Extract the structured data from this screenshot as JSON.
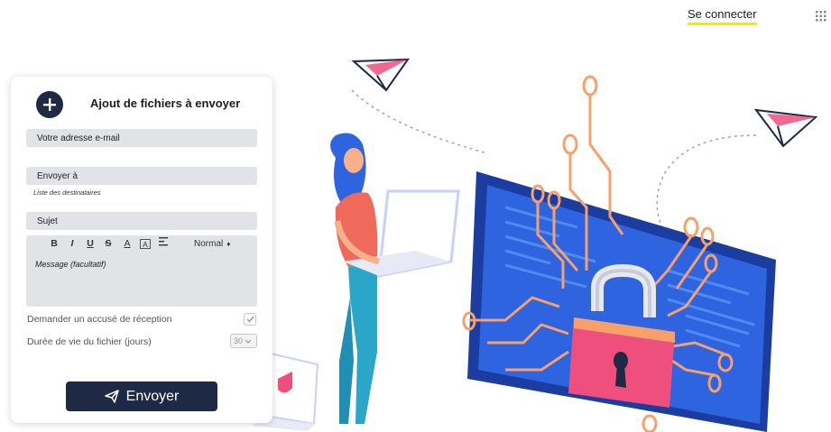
{
  "header": {
    "login_label": "Se connecter",
    "apps_icon": "grid-icon"
  },
  "form": {
    "add_files_icon": "plus-icon",
    "title": "Ajout de fichiers à envoyer",
    "email_placeholder": "Votre adresse e-mail",
    "recipients_placeholder": "Envoyer à",
    "recipients_hint": "Liste des destinataires",
    "subject_placeholder": "Sujet",
    "toolbar": {
      "bold": "B",
      "italic": "I",
      "underline": "U",
      "strike": "S",
      "text_color": "A",
      "background_color": "A",
      "align_icon": "align-left-icon",
      "heading_value": "Normal"
    },
    "message_placeholder": "Message (facultatif)",
    "receipt_label": "Demander un accusé de réception",
    "receipt_checked": true,
    "lifetime_label": "Durée de vie du fichier (jours)",
    "lifetime_value": "30",
    "send_icon": "paper-plane-icon",
    "send_label": "Envoyer"
  },
  "colors": {
    "primary_dark": "#1e2945",
    "accent_yellow": "#f5e12a",
    "field_bg": "#e1e3e6",
    "illustration_blue": "#2b5fd6",
    "illustration_orange": "#f7a06a",
    "illustration_pink": "#ef4f7d"
  }
}
